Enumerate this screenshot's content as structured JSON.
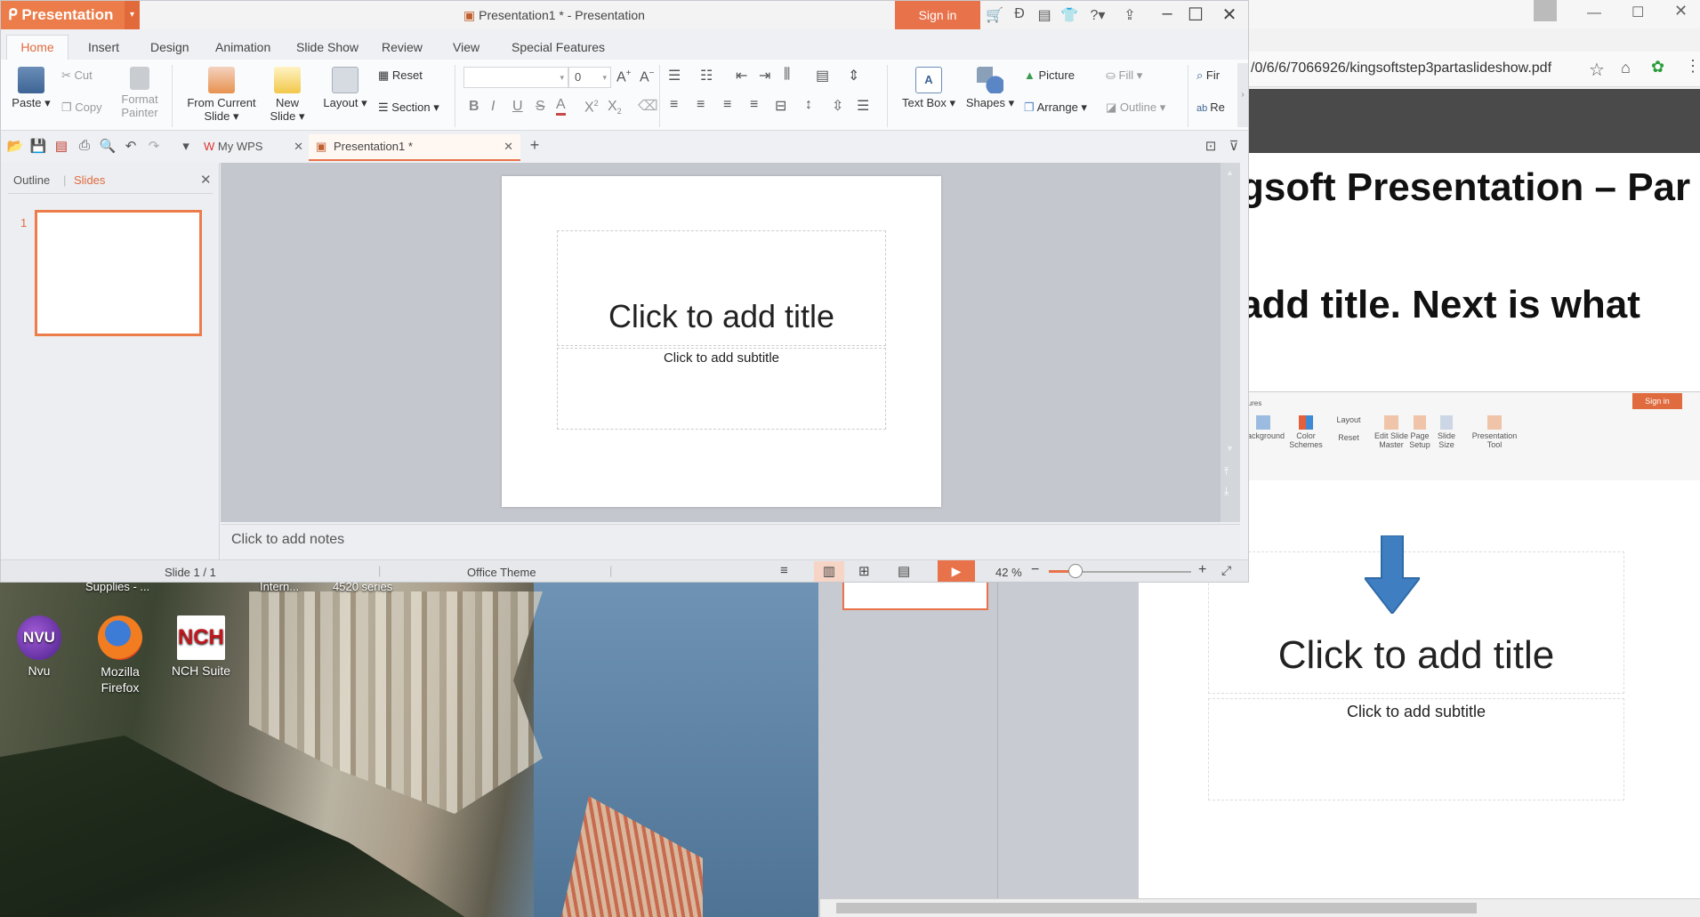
{
  "wps": {
    "app_name": "Presentation",
    "title": "Presentation1 * - Presentation",
    "signin": "Sign in",
    "tabs": [
      "Home",
      "Insert",
      "Design",
      "Animation",
      "Slide Show",
      "Review",
      "View",
      "Special Features"
    ],
    "ribbon": {
      "paste": "Paste",
      "cut": "Cut",
      "copy": "Copy",
      "format_painter_1": "Format",
      "format_painter_2": "Painter",
      "from_current_1": "From Current",
      "from_current_2": "Slide",
      "new_slide_1": "New",
      "new_slide_2": "Slide",
      "layout": "Layout",
      "reset": "Reset",
      "section": "Section",
      "font_size": "0",
      "text_box": "Text Box",
      "shapes": "Shapes",
      "picture": "Picture",
      "arrange": "Arrange",
      "fill": "Fill",
      "outline": "Outline",
      "find": "Fir",
      "replace": "Re"
    },
    "doc_tabs": {
      "mywps": "My WPS",
      "doc": "Presentation1 *"
    },
    "pane_tabs": {
      "outline": "Outline",
      "slides": "Slides"
    },
    "slide_number": "1",
    "slide": {
      "title": "Click to add title",
      "subtitle": "Click to add subtitle"
    },
    "notes": "Click to add notes",
    "status": {
      "slide": "Slide 1 / 1",
      "theme": "Office Theme",
      "zoom": "42 %"
    },
    "zoom_fraction": 0.42
  },
  "desktop_icons": [
    {
      "label": "Nvu"
    },
    {
      "label": "Mozilla Firefox"
    },
    {
      "label": "NCH Suite"
    }
  ],
  "desktop_partial_labels": [
    "Supplies - ...",
    "Intern...",
    "4520 series"
  ],
  "browser": {
    "url": "/0/6/6/7066926/kingsoftstep3partaslideshow.pdf",
    "heading1": "gsoft Presentation – Par",
    "heading2": "add title.  Next is what",
    "mini_ribbon": {
      "features": "atures",
      "signin": "Sign in",
      "background": "Background",
      "color_schemes": "Color Schemes",
      "layout": "Layout",
      "reset": "Reset",
      "edit_slide_master": "Edit Slide Master",
      "page_setup": "Page Setup",
      "slide_size": "Slide Size",
      "presentation_tool": "Presentation Tool"
    },
    "slide": {
      "title": "Click to add title",
      "subtitle": "Click to add subtitle"
    }
  },
  "colors": {
    "accent": "#e8724a",
    "brand": "#ec7d4a",
    "arrow": "#3f7fc1"
  }
}
